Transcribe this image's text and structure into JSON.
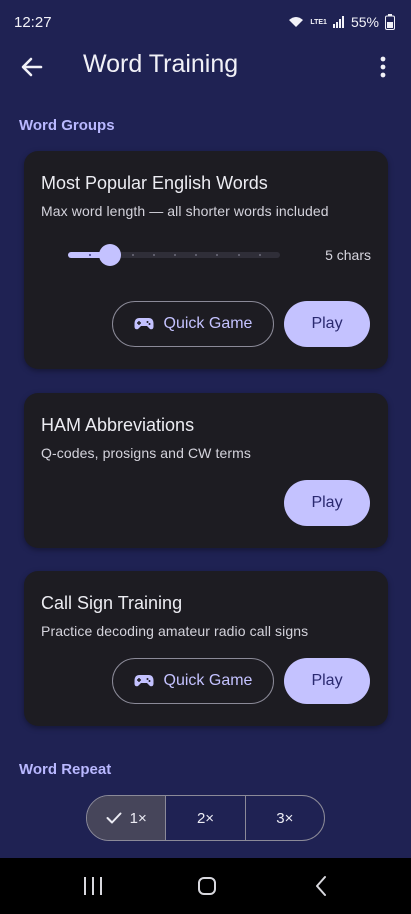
{
  "status": {
    "time": "12:27",
    "network": "LTE1",
    "battery": "55%"
  },
  "app_bar": {
    "title": "Word Training"
  },
  "sections": {
    "word_groups": "Word Groups",
    "word_repeat": "Word Repeat"
  },
  "cards": [
    {
      "title": "Most Popular English Words",
      "subtitle": "Max word length — all shorter words included",
      "slider": {
        "value_label": "5 chars",
        "position_fraction": 0.2,
        "steps": 10
      },
      "quick_game_label": "Quick Game",
      "play_label": "Play"
    },
    {
      "title": "HAM Abbreviations",
      "subtitle": "Q-codes, prosigns and CW terms",
      "play_label": "Play"
    },
    {
      "title": "Call Sign Training",
      "subtitle": "Practice decoding amateur radio call signs",
      "quick_game_label": "Quick Game",
      "play_label": "Play"
    }
  ],
  "repeat_options": [
    {
      "label": "1×",
      "selected": true
    },
    {
      "label": "2×",
      "selected": false
    },
    {
      "label": "3×",
      "selected": false
    }
  ],
  "icons": {
    "back": "arrow-left-icon",
    "more": "more-vert-icon",
    "gamepad": "gamepad-icon",
    "check": "check-icon",
    "nav_recents": "recents-icon",
    "nav_home": "home-icon",
    "nav_back": "nav-back-icon"
  },
  "colors": {
    "background": "#1f2253",
    "card": "#1d1c22",
    "accent": "#c4c2ff",
    "section_title": "#b9b8ff"
  }
}
